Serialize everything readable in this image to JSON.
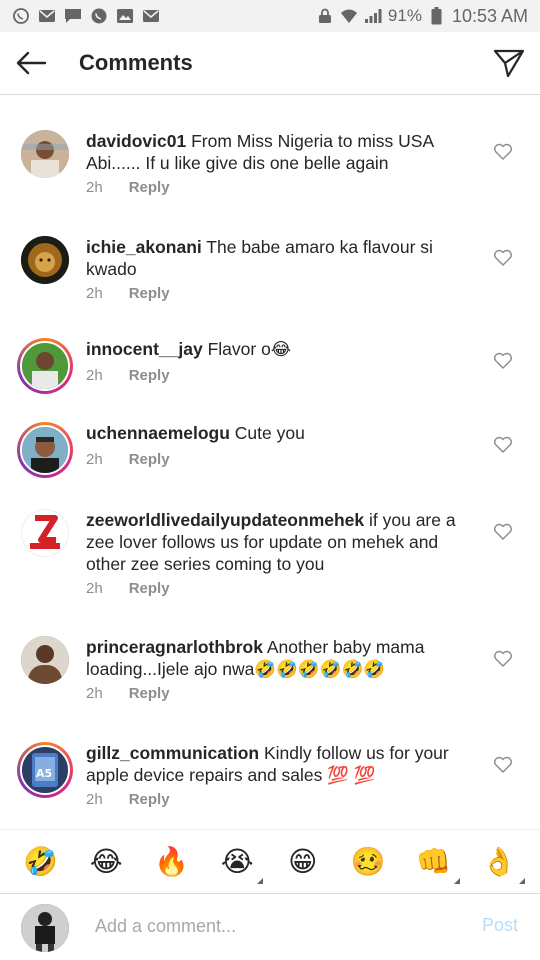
{
  "status_bar": {
    "battery": "91%",
    "time": "10:53 AM",
    "left_icons": [
      "whatsapp-icon",
      "mail-icon",
      "message-icon",
      "whatsapp-icon",
      "image-icon",
      "mail-icon"
    ],
    "right_icons": [
      "lock-icon",
      "wifi-icon",
      "signal-icon",
      "battery-icon"
    ]
  },
  "header": {
    "title": "Comments",
    "back_icon": "arrow-left-icon",
    "share_icon": "send-icon"
  },
  "comments": [
    {
      "username": "davidovic01",
      "text": " From Miss Nigeria to miss USA Abi...... If u like give dis one belle again",
      "time": "2h",
      "reply": "Reply",
      "avatar_color": "#b88a6a",
      "ring": false
    },
    {
      "username": "ichie_akonani",
      "text": " The babe amaro ka flavour si kwado",
      "time": "2h",
      "reply": "Reply",
      "avatar_color": "#6b4a1f",
      "ring": false
    },
    {
      "username": "innocent__jay",
      "text": " Flavor o😂",
      "time": "2h",
      "reply": "Reply",
      "avatar_color": "#3d8a2c",
      "ring": true
    },
    {
      "username": "uchennaemelogu",
      "text": " Cute you",
      "time": "2h",
      "reply": "Reply",
      "avatar_color": "#6ea0b8",
      "ring": true
    },
    {
      "username": "zeeworldlivedailyupdateonmehek",
      "text": " if you are a zee lover follows us for update on mehek and other zee series coming to you",
      "time": "2h",
      "reply": "Reply",
      "avatar_color": "#ffffff",
      "ring": false
    },
    {
      "username": "princeragnarlothbrok",
      "text": " Another baby mama loading...Ijele ajo nwa🤣🤣🤣🤣🤣🤣",
      "time": "2h",
      "reply": "Reply",
      "avatar_color": "#8a6a55",
      "ring": false
    },
    {
      "username": "gillz_communication",
      "text": " Kindly follow us for your apple device repairs and sales 💯 💯",
      "time": "2h",
      "reply": "Reply",
      "avatar_color": "#3b6fb0",
      "ring": true
    }
  ],
  "emoji_bar": [
    "🤣",
    "😂",
    "🔥",
    "😭",
    "😁",
    "🥴",
    "👊",
    "👌"
  ],
  "composer": {
    "placeholder": "Add a comment...",
    "post_label": "Post"
  },
  "colors": {
    "accent": "#3897f0",
    "post_disabled": "#b2dffc",
    "meta_gray": "#8e8e8e"
  }
}
